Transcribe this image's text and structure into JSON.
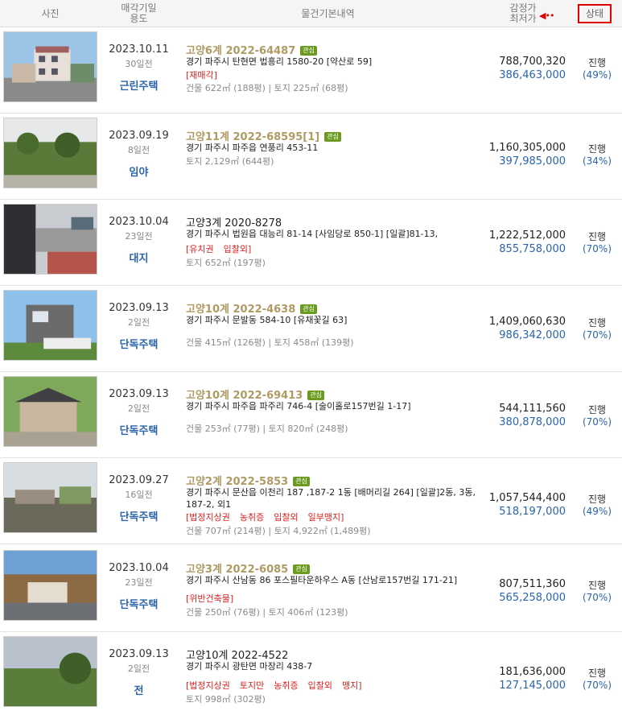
{
  "header": {
    "photo": "사진",
    "date_line1": "매각기일",
    "date_line2": "용도",
    "info": "물건기본내역",
    "price_line1": "감정가",
    "price_line2": "최저가",
    "status": "상태"
  },
  "rows": [
    {
      "date": "2023.10.11",
      "ago": "30일전",
      "usage": "근린주택",
      "case": "고양6계 2022-64487",
      "case_highlight": true,
      "badge": "관심",
      "addr": "경기 파주시 탄현면 법흥리 1580-20 [약산로 59]",
      "tags": [
        "[재매각]"
      ],
      "area": "건물 622㎡ (188평)   |   토지 225㎡ (68평)",
      "appraisal": "788,700,320",
      "minimum": "386,463,000",
      "status": "진행",
      "percent": "(49%)"
    },
    {
      "date": "2023.09.19",
      "ago": "8일전",
      "usage": "임야",
      "case": "고양11계 2022-68595[1]",
      "case_highlight": true,
      "badge": "관심",
      "addr": "경기 파주시 파주읍 연풍리 453-11",
      "tags": [],
      "area": "토지 2,129㎡ (644평)",
      "appraisal": "1,160,305,000",
      "minimum": "397,985,000",
      "status": "진행",
      "percent": "(34%)"
    },
    {
      "date": "2023.10.04",
      "ago": "23일전",
      "usage": "대지",
      "case": "고양3계 2020-8278",
      "case_highlight": false,
      "badge": "",
      "addr": "경기 파주시 법원읍 대능리 81-14 [사임당로 850-1]  [일괄]81-13,",
      "tags": [
        "[유치권",
        "입찰외]"
      ],
      "area": "토지 652㎡ (197평)",
      "appraisal": "1,222,512,000",
      "minimum": "855,758,000",
      "status": "진행",
      "percent": "(70%)"
    },
    {
      "date": "2023.09.13",
      "ago": "2일전",
      "usage": "단독주택",
      "case": "고양10계 2022-4638",
      "case_highlight": true,
      "badge": "관심",
      "addr": "경기 파주시 문발동 584-10 [유채꽃길 63]",
      "tags": [],
      "area": "건물 415㎡ (126평)   |   토지 458㎡ (139평)",
      "appraisal": "1,409,060,630",
      "minimum": "986,342,000",
      "status": "진행",
      "percent": "(70%)"
    },
    {
      "date": "2023.09.13",
      "ago": "2일전",
      "usage": "단독주택",
      "case": "고양10계 2022-69413",
      "case_highlight": true,
      "badge": "관심",
      "addr": "경기 파주시 파주읍 파주리 746-4 [술이홀로157번길 1-17]",
      "tags": [],
      "area": "건물 253㎡ (77평)   |   토지 820㎡ (248평)",
      "appraisal": "544,111,560",
      "minimum": "380,878,000",
      "status": "진행",
      "percent": "(70%)"
    },
    {
      "date": "2023.09.27",
      "ago": "16일전",
      "usage": "단독주택",
      "case": "고양2계 2022-5853",
      "case_highlight": true,
      "badge": "관심",
      "addr": "경기 파주시 문산읍 이천리 187 ,187-2 1동 [배머리길 264]  [일괄]2동, 3동, 187-2, 외1",
      "tags": [
        "[법정지상권",
        "농취증",
        "입찰외",
        "일부맹지]"
      ],
      "area": "건물 707㎡ (214평)   |   토지 4,922㎡ (1,489평)",
      "appraisal": "1,057,544,400",
      "minimum": "518,197,000",
      "status": "진행",
      "percent": "(49%)"
    },
    {
      "date": "2023.10.04",
      "ago": "23일전",
      "usage": "단독주택",
      "case": "고양3계 2022-6085",
      "case_highlight": true,
      "badge": "관심",
      "addr": "경기 파주시 산남동 86 포스필타운하우스 A동 [산남로157번길 171-21]",
      "tags": [
        "[위반건축물]"
      ],
      "area": "건물 250㎡ (76평)   |   토지 406㎡ (123평)",
      "appraisal": "807,511,360",
      "minimum": "565,258,000",
      "status": "진행",
      "percent": "(70%)"
    },
    {
      "date": "2023.09.13",
      "ago": "2일전",
      "usage": "전",
      "case": "고양10계 2022-4522",
      "case_highlight": false,
      "badge": "",
      "addr": "경기 파주시 광탄면 마장리 438-7",
      "tags": [
        "[법정지상권",
        "토지만",
        "농취증",
        "입찰외",
        "맹지]"
      ],
      "area": "토지 998㎡ (302평)",
      "appraisal": "181,636,000",
      "minimum": "127,145,000",
      "status": "진행",
      "percent": "(70%)"
    }
  ]
}
